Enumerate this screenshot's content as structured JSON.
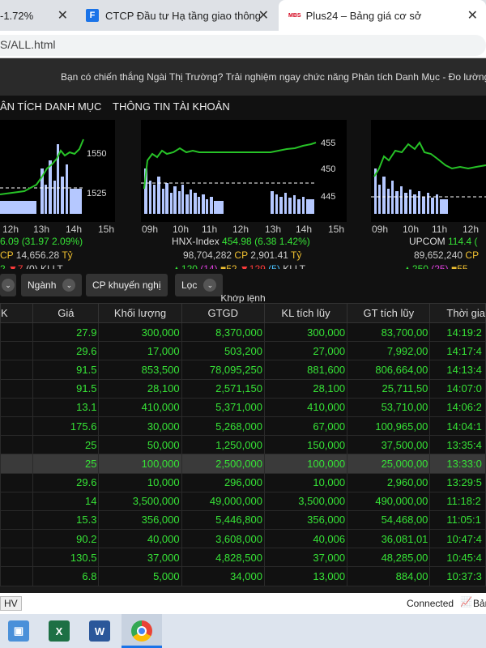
{
  "browser": {
    "tabs": [
      {
        "label": "-1.72%"
      },
      {
        "label": "CTCP Đầu tư Hạ tầng giao thông",
        "favicon": "F"
      },
      {
        "label": "Plus24 – Bảng giá cơ sở",
        "favicon": "MBS"
      }
    ],
    "url": "S/ALL.html"
  },
  "banner": "Bạn có chiến thắng Ngài Thị Trường? Trải nghiệm ngay chức năng Phân tích Danh Mục - Đo lường",
  "menu": [
    "ÂN TÍCH DANH MỤC",
    "THÔNG TIN TÀI KHOẢN"
  ],
  "charts": [
    {
      "times": [
        "12h",
        "13h",
        "14h",
        "15h"
      ],
      "levels": [
        "1550",
        "1525"
      ],
      "index_line": "6.09 (31.97 2.09%)",
      "value_line_prefix": "CP",
      "value": "14,656.28",
      "unit": "Tỷ",
      "up": "2",
      "down": "7",
      "paren": "(0)",
      "kllt": "KLLT"
    },
    {
      "times": [
        "09h",
        "10h",
        "11h",
        "12h",
        "13h",
        "14h",
        "15h"
      ],
      "levels": [
        "455",
        "450",
        "445"
      ],
      "name": "HNX-Index",
      "index_line": "454.98 (6.38 1.42%)",
      "volume": "98,704,282",
      "value_line_prefix": "CP",
      "value": "2,901.41",
      "unit": "Tỷ",
      "up": "120",
      "ref": "(14)",
      "ceil": "52",
      "down": "129",
      "floor": "(5)",
      "kllt": "KLLT"
    },
    {
      "times": [
        "09h",
        "10h",
        "11h",
        "12h"
      ],
      "name": "UPCOM",
      "index_line": "114.4 (",
      "volume": "89,652,240",
      "value_line_prefix": "CP",
      "up": "250",
      "ref": "(25)",
      "ceil": "55"
    }
  ],
  "filters": {
    "industry": "Ngành",
    "recommend": "CP khuyến nghị",
    "filter": "Lọc"
  },
  "table": {
    "group_header": "Khớp lệnh",
    "headers": [
      "K",
      "Giá",
      "Khối lượng",
      "GTGD",
      "KL tích lũy",
      "GT tích lũy",
      "Thời gia"
    ],
    "rows": [
      [
        "",
        "27.9",
        "300,000",
        "8,370,000",
        "300,000",
        "83,700,00",
        "14:19:2"
      ],
      [
        "",
        "29.6",
        "17,000",
        "503,200",
        "27,000",
        "7,992,00",
        "14:17:4"
      ],
      [
        "",
        "91.5",
        "853,500",
        "78,095,250",
        "881,600",
        "806,664,00",
        "14:13:4"
      ],
      [
        "",
        "91.5",
        "28,100",
        "2,571,150",
        "28,100",
        "25,711,50",
        "14:07:0"
      ],
      [
        "",
        "13.1",
        "410,000",
        "5,371,000",
        "410,000",
        "53,710,00",
        "14:06:2"
      ],
      [
        "",
        "175.6",
        "30,000",
        "5,268,000",
        "67,000",
        "100,965,00",
        "14:04:1"
      ],
      [
        "",
        "25",
        "50,000",
        "1,250,000",
        "150,000",
        "37,500,00",
        "13:35:4"
      ],
      [
        "",
        "25",
        "100,000",
        "2,500,000",
        "100,000",
        "25,000,00",
        "13:33:0"
      ],
      [
        "",
        "29.6",
        "10,000",
        "296,000",
        "10,000",
        "2,960,00",
        "13:29:5"
      ],
      [
        "",
        "14",
        "3,500,000",
        "49,000,000",
        "3,500,000",
        "490,000,00",
        "11:18:2"
      ],
      [
        "",
        "15.3",
        "356,000",
        "5,446,800",
        "356,000",
        "54,468,00",
        "11:05:1"
      ],
      [
        "",
        "90.2",
        "40,000",
        "3,608,000",
        "40,006",
        "36,081,01",
        "10:47:4"
      ],
      [
        "",
        "130.5",
        "37,000",
        "4,828,500",
        "37,000",
        "48,285,00",
        "10:45:4"
      ],
      [
        "",
        "6.8",
        "5,000",
        "34,000",
        "13,000",
        "884,00",
        "10:37:3"
      ]
    ],
    "selected_row": 7
  },
  "status": {
    "left": "HV",
    "connected": "Connected",
    "right": "Bản"
  },
  "taskbar": [
    "photos-app-icon",
    "excel-app-icon",
    "word-app-icon",
    "chrome-app-icon"
  ]
}
